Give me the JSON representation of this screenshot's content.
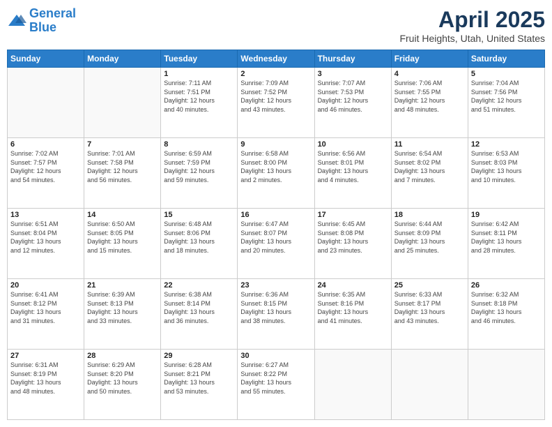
{
  "header": {
    "logo_line1": "General",
    "logo_line2": "Blue",
    "main_title": "April 2025",
    "subtitle": "Fruit Heights, Utah, United States"
  },
  "days_of_week": [
    "Sunday",
    "Monday",
    "Tuesday",
    "Wednesday",
    "Thursday",
    "Friday",
    "Saturday"
  ],
  "weeks": [
    [
      {
        "num": "",
        "info": ""
      },
      {
        "num": "",
        "info": ""
      },
      {
        "num": "1",
        "info": "Sunrise: 7:11 AM\nSunset: 7:51 PM\nDaylight: 12 hours\nand 40 minutes."
      },
      {
        "num": "2",
        "info": "Sunrise: 7:09 AM\nSunset: 7:52 PM\nDaylight: 12 hours\nand 43 minutes."
      },
      {
        "num": "3",
        "info": "Sunrise: 7:07 AM\nSunset: 7:53 PM\nDaylight: 12 hours\nand 46 minutes."
      },
      {
        "num": "4",
        "info": "Sunrise: 7:06 AM\nSunset: 7:55 PM\nDaylight: 12 hours\nand 48 minutes."
      },
      {
        "num": "5",
        "info": "Sunrise: 7:04 AM\nSunset: 7:56 PM\nDaylight: 12 hours\nand 51 minutes."
      }
    ],
    [
      {
        "num": "6",
        "info": "Sunrise: 7:02 AM\nSunset: 7:57 PM\nDaylight: 12 hours\nand 54 minutes."
      },
      {
        "num": "7",
        "info": "Sunrise: 7:01 AM\nSunset: 7:58 PM\nDaylight: 12 hours\nand 56 minutes."
      },
      {
        "num": "8",
        "info": "Sunrise: 6:59 AM\nSunset: 7:59 PM\nDaylight: 12 hours\nand 59 minutes."
      },
      {
        "num": "9",
        "info": "Sunrise: 6:58 AM\nSunset: 8:00 PM\nDaylight: 13 hours\nand 2 minutes."
      },
      {
        "num": "10",
        "info": "Sunrise: 6:56 AM\nSunset: 8:01 PM\nDaylight: 13 hours\nand 4 minutes."
      },
      {
        "num": "11",
        "info": "Sunrise: 6:54 AM\nSunset: 8:02 PM\nDaylight: 13 hours\nand 7 minutes."
      },
      {
        "num": "12",
        "info": "Sunrise: 6:53 AM\nSunset: 8:03 PM\nDaylight: 13 hours\nand 10 minutes."
      }
    ],
    [
      {
        "num": "13",
        "info": "Sunrise: 6:51 AM\nSunset: 8:04 PM\nDaylight: 13 hours\nand 12 minutes."
      },
      {
        "num": "14",
        "info": "Sunrise: 6:50 AM\nSunset: 8:05 PM\nDaylight: 13 hours\nand 15 minutes."
      },
      {
        "num": "15",
        "info": "Sunrise: 6:48 AM\nSunset: 8:06 PM\nDaylight: 13 hours\nand 18 minutes."
      },
      {
        "num": "16",
        "info": "Sunrise: 6:47 AM\nSunset: 8:07 PM\nDaylight: 13 hours\nand 20 minutes."
      },
      {
        "num": "17",
        "info": "Sunrise: 6:45 AM\nSunset: 8:08 PM\nDaylight: 13 hours\nand 23 minutes."
      },
      {
        "num": "18",
        "info": "Sunrise: 6:44 AM\nSunset: 8:09 PM\nDaylight: 13 hours\nand 25 minutes."
      },
      {
        "num": "19",
        "info": "Sunrise: 6:42 AM\nSunset: 8:11 PM\nDaylight: 13 hours\nand 28 minutes."
      }
    ],
    [
      {
        "num": "20",
        "info": "Sunrise: 6:41 AM\nSunset: 8:12 PM\nDaylight: 13 hours\nand 31 minutes."
      },
      {
        "num": "21",
        "info": "Sunrise: 6:39 AM\nSunset: 8:13 PM\nDaylight: 13 hours\nand 33 minutes."
      },
      {
        "num": "22",
        "info": "Sunrise: 6:38 AM\nSunset: 8:14 PM\nDaylight: 13 hours\nand 36 minutes."
      },
      {
        "num": "23",
        "info": "Sunrise: 6:36 AM\nSunset: 8:15 PM\nDaylight: 13 hours\nand 38 minutes."
      },
      {
        "num": "24",
        "info": "Sunrise: 6:35 AM\nSunset: 8:16 PM\nDaylight: 13 hours\nand 41 minutes."
      },
      {
        "num": "25",
        "info": "Sunrise: 6:33 AM\nSunset: 8:17 PM\nDaylight: 13 hours\nand 43 minutes."
      },
      {
        "num": "26",
        "info": "Sunrise: 6:32 AM\nSunset: 8:18 PM\nDaylight: 13 hours\nand 46 minutes."
      }
    ],
    [
      {
        "num": "27",
        "info": "Sunrise: 6:31 AM\nSunset: 8:19 PM\nDaylight: 13 hours\nand 48 minutes."
      },
      {
        "num": "28",
        "info": "Sunrise: 6:29 AM\nSunset: 8:20 PM\nDaylight: 13 hours\nand 50 minutes."
      },
      {
        "num": "29",
        "info": "Sunrise: 6:28 AM\nSunset: 8:21 PM\nDaylight: 13 hours\nand 53 minutes."
      },
      {
        "num": "30",
        "info": "Sunrise: 6:27 AM\nSunset: 8:22 PM\nDaylight: 13 hours\nand 55 minutes."
      },
      {
        "num": "",
        "info": ""
      },
      {
        "num": "",
        "info": ""
      },
      {
        "num": "",
        "info": ""
      }
    ]
  ]
}
